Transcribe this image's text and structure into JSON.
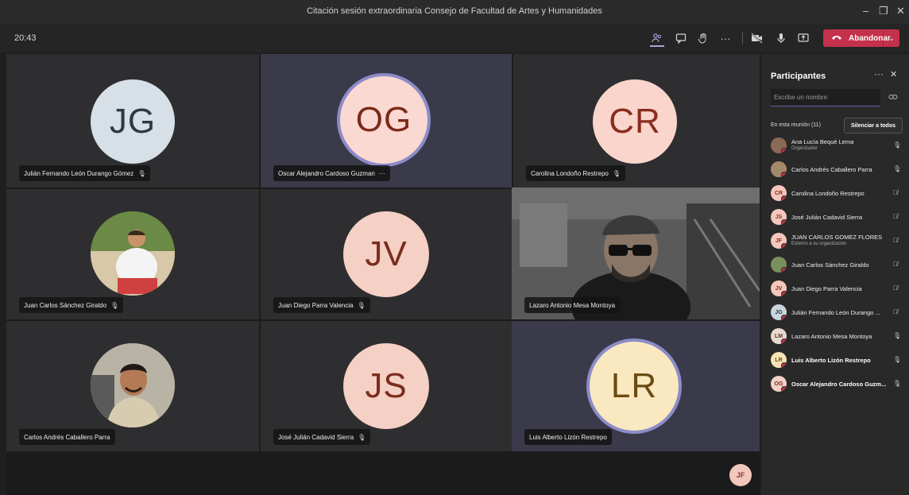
{
  "window": {
    "title": "Citación sesión extraordinaria Consejo de Facultad de Artes y Humanidades",
    "minimize": "–",
    "restore": "❐",
    "close": "✕"
  },
  "toolbar": {
    "clock": "20:43",
    "leave_label": "Abandonar",
    "leave_dropdown": "⌄"
  },
  "tiles": [
    {
      "name": "Julián Fernando León Durango Gómez",
      "initials": "JG",
      "avatar_bg": "#d6e0e6",
      "avatar_fg": "#2e3a40",
      "mic": "🎙"
    },
    {
      "name": "Oscar Alejandro Cardoso Guzman",
      "initials": "OG",
      "avatar_bg": "#fad9d2",
      "avatar_fg": "#7b2a1a",
      "extra": "···"
    },
    {
      "name": "Carolina Londoño Restrepo",
      "initials": "CR",
      "avatar_bg": "#f9d5cc",
      "avatar_fg": "#8a2d1c",
      "mic": "🎙"
    },
    {
      "name": "Juan Carlos Sánchez Giraldo",
      "mic": "🎙"
    },
    {
      "name": "Juan Diego Parra Valencia",
      "initials": "JV",
      "avatar_bg": "#f5d0c5",
      "avatar_fg": "#7a2d1e",
      "mic": "🎙"
    },
    {
      "name": "Lazaro Antonio Mesa Montoya"
    },
    {
      "name": "Carlos Andrés Caballero Parra"
    },
    {
      "name": "José Julián Cadavid Sierra",
      "initials": "JS",
      "avatar_bg": "#f5d0c5",
      "avatar_fg": "#7a2d1e",
      "mic": "🎙"
    },
    {
      "name": "Luis Alberto Lizón Restrepo",
      "initials": "LR",
      "avatar_bg": "#fae8c0",
      "avatar_fg": "#6a4b12"
    }
  ],
  "self_avatar": "JF",
  "panel": {
    "title": "Participantes",
    "more": "···",
    "close": "✕",
    "search_placeholder": "Escribe un nombre",
    "meeting_label": "En esta reunión (11)",
    "mute_all": "Silenciar a todos",
    "participants": [
      {
        "name": "Ana Lucía Bequé Lema",
        "sub": "Organizador",
        "initials": "",
        "bg": "#8a6a55",
        "fg": "#fff",
        "mic": "🎙"
      },
      {
        "name": "Carlos Andrés Caballero Parra",
        "initials": "",
        "bg": "#a48a6a",
        "fg": "#fff",
        "mic": "🎙"
      },
      {
        "name": "Carolina Londoño Restrepo",
        "initials": "CR",
        "bg": "#f5c7bc",
        "fg": "#8a2d1c",
        "mic": "🎙̸"
      },
      {
        "name": "José Julián Cadavid Sierra",
        "initials": "JS",
        "bg": "#f5c7bc",
        "fg": "#8a2d1c",
        "mic": "🎙̸"
      },
      {
        "name": "JUAN CARLOS GOMEZ FLORES",
        "sub": "Externo a su organización",
        "initials": "JF",
        "bg": "#f5c7bc",
        "fg": "#8a2d1c",
        "mic": "🎙̸"
      },
      {
        "name": "Juan Carlos Sánchez Giraldo",
        "initials": "",
        "bg": "#7a8f5a",
        "fg": "#fff",
        "mic": "🎙̸"
      },
      {
        "name": "Juan Diego Parra Valencia",
        "initials": "JV",
        "bg": "#f5c7bc",
        "fg": "#8a2d1c",
        "mic": "🎙̸"
      },
      {
        "name": "Julián Fernando León Durango ...",
        "initials": "JG",
        "bg": "#c9d6dd",
        "fg": "#2e3a40",
        "mic": "🎙̸"
      },
      {
        "name": "Lazaro Antonio Mesa Montoya",
        "initials": "LM",
        "bg": "#e8d9cf",
        "fg": "#5b3a2a",
        "mic": "🎙"
      },
      {
        "name": "Luis Alberto Lizón Restrepo",
        "initials": "LR",
        "bg": "#f7e3b5",
        "fg": "#6a4b12",
        "bold": true,
        "mic": "🎙"
      },
      {
        "name": "Oscar Alejandro Cardoso Guzm...",
        "initials": "OG",
        "bg": "#f3d0c8",
        "fg": "#7b2a1a",
        "bold": true,
        "mic": "🎙"
      }
    ]
  }
}
